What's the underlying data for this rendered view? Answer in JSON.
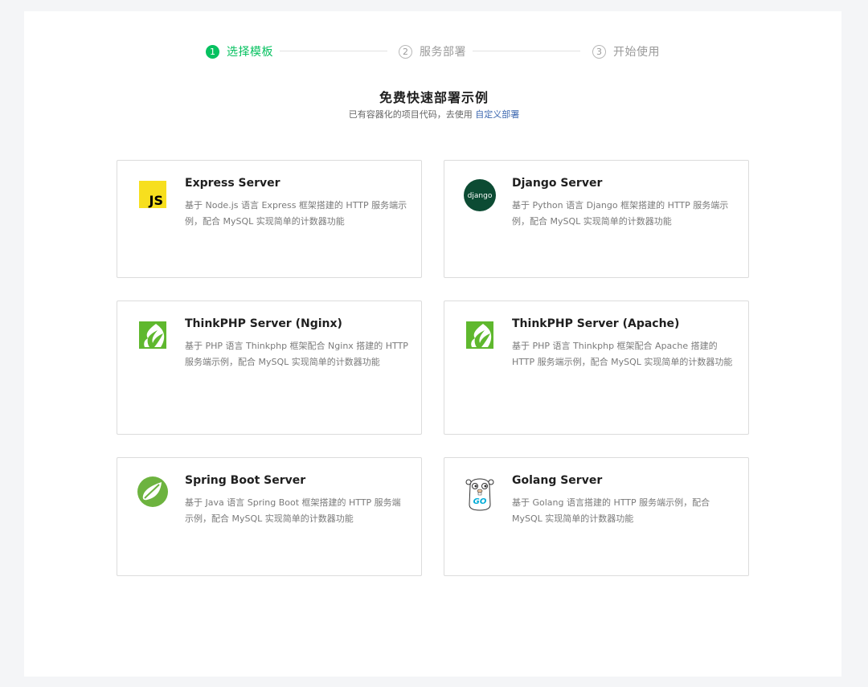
{
  "stepper": {
    "steps": [
      {
        "num": "1",
        "label": "选择模板"
      },
      {
        "num": "2",
        "label": "服务部署"
      },
      {
        "num": "3",
        "label": "开始使用"
      }
    ]
  },
  "header": {
    "title": "免费快速部署示例",
    "subtitle_prefix": "已有容器化的项目代码，去使用 ",
    "subtitle_link": "自定义部署"
  },
  "templates": [
    {
      "title": "Express Server",
      "icon": "javascript-icon",
      "icon_text": "JS",
      "desc": "基于 Node.js 语言 Express 框架搭建的 HTTP 服务端示例，配合 MySQL 实现简单的计数器功能"
    },
    {
      "title": "Django Server",
      "icon": "django-icon",
      "icon_text": "django",
      "desc": "基于 Python 语言 Django 框架搭建的 HTTP 服务端示例，配合 MySQL 实现简单的计数器功能"
    },
    {
      "title": "ThinkPHP Server (Nginx)",
      "icon": "thinkphp-icon",
      "desc": "基于 PHP 语言 Thinkphp 框架配合 Nginx 搭建的 HTTP 服务端示例，配合 MySQL 实现简单的计数器功能"
    },
    {
      "title": "ThinkPHP Server (Apache)",
      "icon": "thinkphp-icon",
      "desc": "基于 PHP 语言 Thinkphp 框架配合 Apache 搭建的 HTTP 服务端示例，配合 MySQL 实现简单的计数器功能"
    },
    {
      "title": "Spring Boot Server",
      "icon": "spring-leaf-icon",
      "desc": "基于 Java 语言 Spring Boot 框架搭建的 HTTP 服务端示例，配合 MySQL 实现简单的计数器功能"
    },
    {
      "title": "Golang Server",
      "icon": "go-gopher-icon",
      "icon_text": "GO",
      "desc": "基于 Golang 语言搭建的 HTTP 服务端示例，配合 MySQL 实现简单的计数器功能"
    }
  ],
  "colors": {
    "accent": "#07c160",
    "link": "#3d68b0",
    "js_yellow": "#f7df1e",
    "django_green": "#0c4b33",
    "thinkphp_green": "#5fb82e",
    "spring_green": "#6db33f",
    "go_blue": "#00acd7"
  }
}
